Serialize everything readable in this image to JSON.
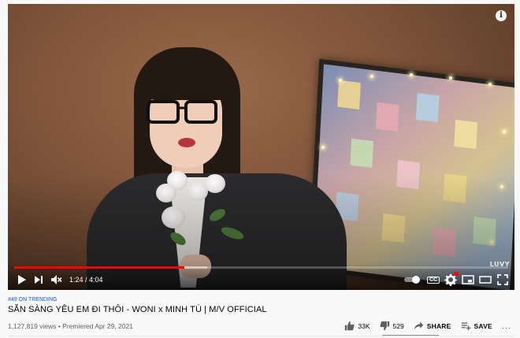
{
  "player": {
    "time_display": "1:24 / 4:04",
    "progress_played": 0.344,
    "progress_buffered": 0.39,
    "watermark": "LUVY",
    "info_glyph": "i",
    "cc_label": "CC",
    "icons": {
      "play": "play-icon",
      "next": "next-icon",
      "mute": "volume-muted-icon",
      "autoplay": "autoplay-toggle-icon",
      "subtitles": "subtitles-icon",
      "settings": "gear-icon",
      "miniplayer": "miniplayer-icon",
      "theater": "theater-mode-icon",
      "fullscreen": "fullscreen-icon"
    },
    "accent_color": "#ff0000"
  },
  "video": {
    "trending_badge": "#49 ON TRENDING",
    "title": "SẴN SÀNG YÊU EM ĐI THÔI - WONI x MINH TÚ | M/V OFFICIAL",
    "views": "1,127,819 views",
    "separator": "•",
    "premiered": "Premiered Apr 29, 2021"
  },
  "actions": {
    "likes": "33K",
    "dislikes": "529",
    "share_label": "SHARE",
    "save_label": "SAVE",
    "more_label": "..."
  }
}
